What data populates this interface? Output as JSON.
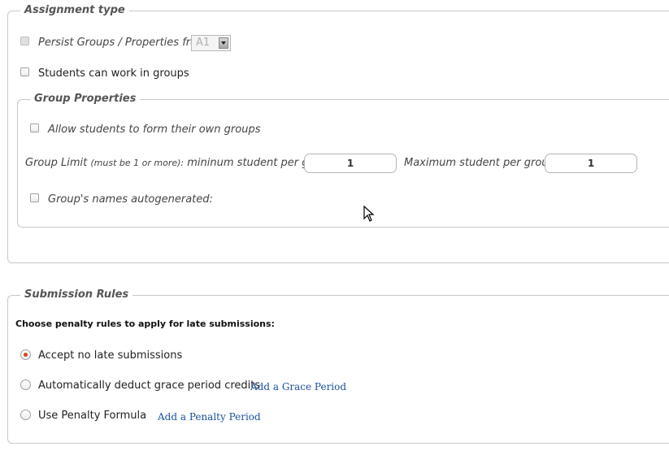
{
  "assignment_type": {
    "legend": "Assignment type",
    "persist_label": "Persist Groups / Properties from",
    "persist_select_value": "A1",
    "students_groups_label": "Students can work in groups"
  },
  "group_properties": {
    "legend": "Group Properties",
    "allow_form_label": "Allow students to form their own groups",
    "group_limit_label": "Group Limit",
    "group_limit_note": "(must be 1 or more):",
    "min_label": "mininum student per group:",
    "min_value": "1",
    "max_label": "Maximum student per group:",
    "max_value": "1",
    "autogenerated_label": "Group's names autogenerated:"
  },
  "submission_rules": {
    "legend": "Submission Rules",
    "instruction": "Choose penalty rules to apply for late submissions:",
    "options": [
      {
        "label": "Accept no late submissions",
        "selected": true
      },
      {
        "label": "Automatically deduct grace period credits",
        "link": "Add a Grace Period",
        "selected": false
      },
      {
        "label": "Use Penalty Formula",
        "link": "Add a Penalty Period",
        "selected": false
      }
    ]
  },
  "colors": {
    "border": "#c8c8c8",
    "radio_selected": "#e04020",
    "link": "#1a4f9c"
  }
}
